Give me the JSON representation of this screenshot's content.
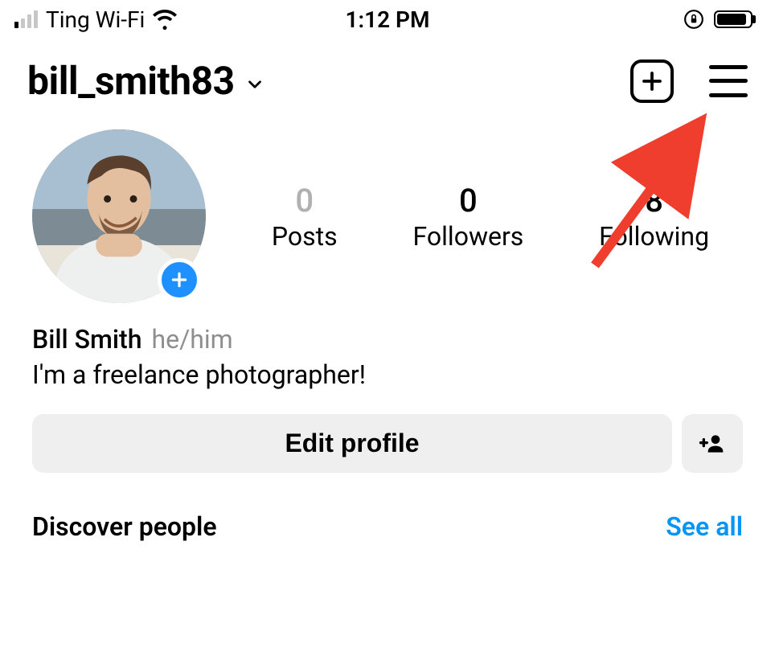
{
  "status": {
    "carrier": "Ting Wi-Fi",
    "time": "1:12 PM"
  },
  "header": {
    "username": "bill_smith83"
  },
  "stats": {
    "posts": {
      "count": "0",
      "label": "Posts"
    },
    "followers": {
      "count": "0",
      "label": "Followers"
    },
    "following": {
      "count": "8",
      "label": "Following"
    }
  },
  "bio": {
    "display_name": "Bill Smith",
    "pronouns": "he/him",
    "text": "I'm a freelance photographer!"
  },
  "actions": {
    "edit_profile": "Edit profile"
  },
  "discover": {
    "title": "Discover people",
    "see_all": "See all"
  }
}
